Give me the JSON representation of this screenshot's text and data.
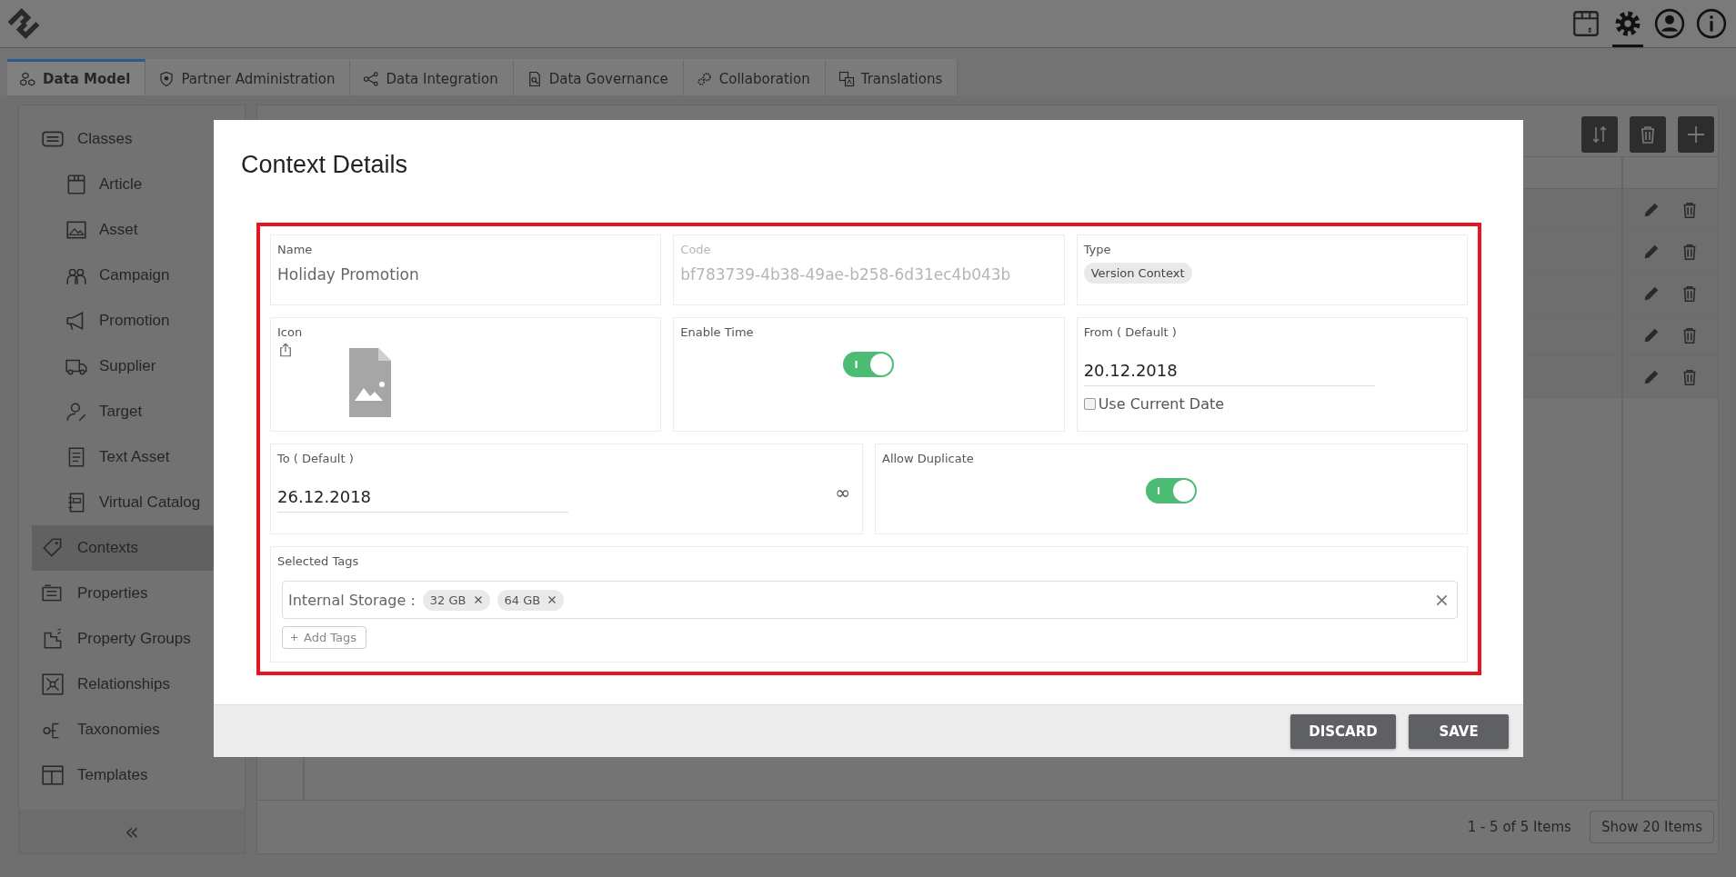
{
  "tabs": [
    {
      "label": "Data Model",
      "selected": true
    },
    {
      "label": "Partner Administration",
      "selected": false
    },
    {
      "label": "Data Integration",
      "selected": false
    },
    {
      "label": "Data Governance",
      "selected": false
    },
    {
      "label": "Collaboration",
      "selected": false
    },
    {
      "label": "Translations",
      "selected": false
    }
  ],
  "sidebar": {
    "items": [
      {
        "label": "Classes",
        "selected": false,
        "children": [
          {
            "label": "Article",
            "selected": false
          },
          {
            "label": "Asset",
            "selected": false
          },
          {
            "label": "Campaign",
            "selected": false
          },
          {
            "label": "Promotion",
            "selected": false
          },
          {
            "label": "Supplier",
            "selected": false
          },
          {
            "label": "Target",
            "selected": false
          },
          {
            "label": "Text Asset",
            "selected": false
          },
          {
            "label": "Virtual Catalog",
            "selected": false
          }
        ]
      },
      {
        "label": "Contexts",
        "selected": true
      },
      {
        "label": "Properties",
        "selected": false
      },
      {
        "label": "Property Groups",
        "selected": false
      },
      {
        "label": "Relationships",
        "selected": false
      },
      {
        "label": "Taxonomies",
        "selected": false
      },
      {
        "label": "Templates",
        "selected": false
      }
    ],
    "collapse_glyph": "«"
  },
  "pagination": {
    "summary": "1 - 5 of 5 Items",
    "page_size_button": "Show 20 Items"
  },
  "dialog": {
    "title": "Context Details",
    "name": {
      "label": "Name",
      "value": "Holiday Promotion"
    },
    "code": {
      "label": "Code",
      "value": "bf783739-4b38-49ae-b258-6d31ec4b043b",
      "disabled": true
    },
    "type": {
      "label": "Type",
      "chip": "Version Context"
    },
    "icon": {
      "label": "Icon"
    },
    "enable_time": {
      "label": "Enable Time",
      "on": true,
      "on_text": "I"
    },
    "from": {
      "label": "From ( Default )",
      "value": "20.12.2018",
      "checkbox": {
        "label": "Use Current Date",
        "checked": false
      }
    },
    "to": {
      "label": "To ( Default )",
      "value": "26.12.2018",
      "end_glyph": "∞"
    },
    "allow_duplicate": {
      "label": "Allow Duplicate",
      "on": true,
      "on_text": "I"
    },
    "selected_tags": {
      "label": "Selected Tags",
      "group": "Internal Storage :",
      "tags": [
        "32 GB",
        "64 GB"
      ],
      "add_label": "Add Tags"
    },
    "buttons": [
      "DISCARD",
      "SAVE"
    ]
  }
}
